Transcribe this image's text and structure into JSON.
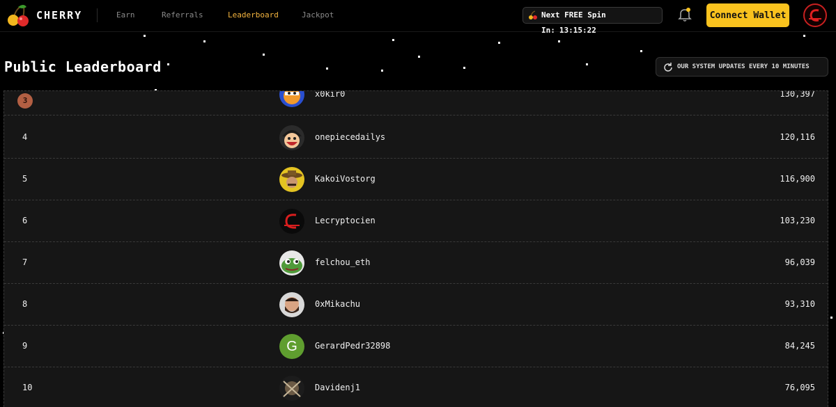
{
  "brand": {
    "name": "CHERRY"
  },
  "nav": {
    "items": [
      {
        "label": "Earn",
        "active": false
      },
      {
        "label": "Referrals",
        "active": false
      },
      {
        "label": "Leaderboard",
        "active": true
      },
      {
        "label": "Jackpot",
        "active": false
      }
    ]
  },
  "spin": {
    "label": "Next FREE Spin In:",
    "time": "13:15:22"
  },
  "header": {
    "connect_label": "Connect Wallet"
  },
  "page": {
    "title": "Public Leaderboard",
    "update_notice": "OUR SYSTEM UPDATES EVERY 10 MINUTES"
  },
  "leaderboard": [
    {
      "rank": "3",
      "username": "x0kir0",
      "score": "130,397",
      "avatar": "orange-face-avatar"
    },
    {
      "rank": "4",
      "username": "onepiecedailys",
      "score": "120,116",
      "avatar": "luffy-avatar"
    },
    {
      "rank": "5",
      "username": "KakoiVostorg",
      "score": "116,900",
      "avatar": "sombrero-avatar"
    },
    {
      "rank": "6",
      "username": "Lecryptocien",
      "score": "103,230",
      "avatar": "red-logo-avatar"
    },
    {
      "rank": "7",
      "username": "felchou_eth",
      "score": "96,039",
      "avatar": "pepe-avatar"
    },
    {
      "rank": "8",
      "username": "0xMikachu",
      "score": "93,310",
      "avatar": "bearded-man-avatar"
    },
    {
      "rank": "9",
      "username": "GerardPedr32898",
      "score": "84,245",
      "avatar": "letter-g-avatar",
      "initial": "G"
    },
    {
      "rank": "10",
      "username": "Davidenj1",
      "score": "76,095",
      "avatar": "dark-art-avatar"
    }
  ],
  "colors": {
    "accent": "#f9c21e",
    "active_nav": "#f5b53f",
    "rank_badge_bronze": "#b25f43",
    "panel": "#161616"
  }
}
